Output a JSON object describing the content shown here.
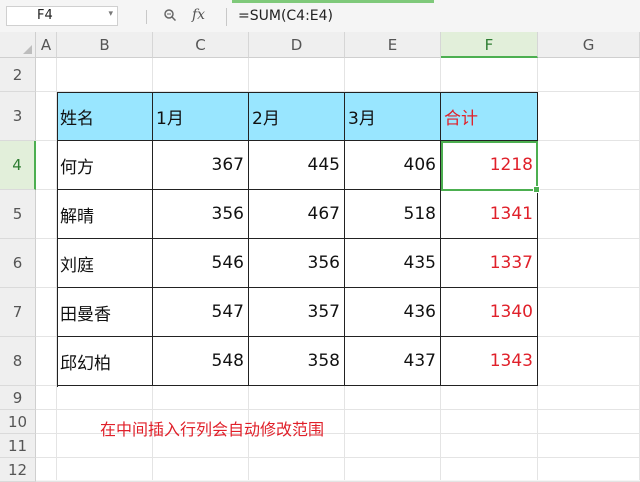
{
  "name_box": "F4",
  "formula_bar": {
    "fx_label": "fx",
    "formula": "=SUM(C4:E4)"
  },
  "columns": [
    "A",
    "B",
    "C",
    "D",
    "E",
    "F",
    "G"
  ],
  "rows": [
    "2",
    "3",
    "4",
    "5",
    "6",
    "7",
    "8",
    "9",
    "10",
    "11",
    "12"
  ],
  "active_column": "F",
  "active_row": "4",
  "table": {
    "headers": [
      "姓名",
      "1月",
      "2月",
      "3月",
      "合计"
    ],
    "rows": [
      [
        "何方",
        "367",
        "445",
        "406",
        "1218"
      ],
      [
        "解晴",
        "356",
        "467",
        "518",
        "1341"
      ],
      [
        "刘庭",
        "546",
        "356",
        "435",
        "1337"
      ],
      [
        "田曼香",
        "547",
        "357",
        "436",
        "1340"
      ],
      [
        "邱幻柏",
        "548",
        "358",
        "437",
        "1343"
      ]
    ]
  },
  "note": "在中间插入行列会自动修改范围",
  "colors": {
    "header_fill": "#99e6ff",
    "total_text": "#e0202a",
    "selection": "#4caf50"
  }
}
